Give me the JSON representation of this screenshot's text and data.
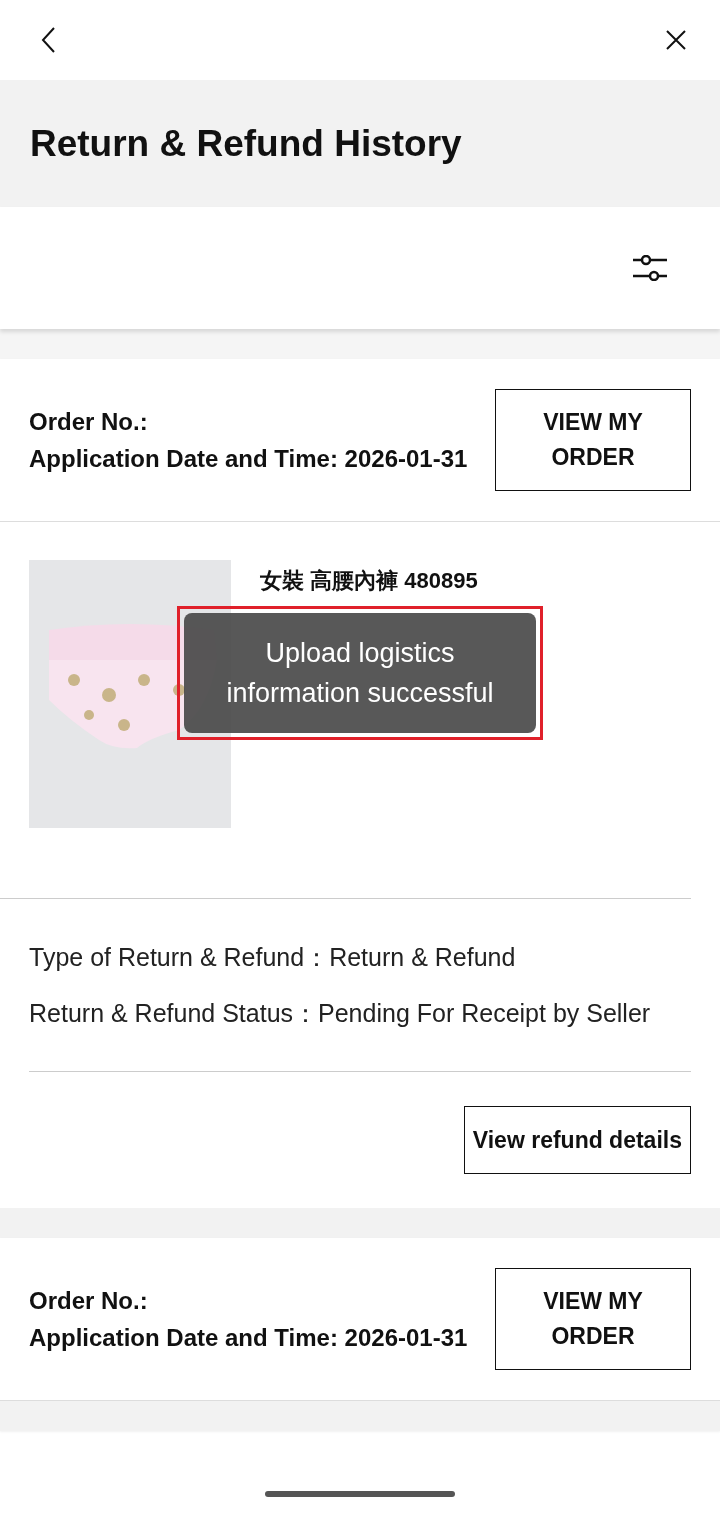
{
  "title": "Return & Refund History",
  "orders": [
    {
      "order_label": "Order No.:",
      "date_line": "Application Date and Time: 2026-01-31",
      "button": "VIEW MY ORDER",
      "product": {
        "name": "女裝 高腰內褲 480895"
      },
      "type_line": "Type of Return & Refund：Return & Refund",
      "status_line": "Return & Refund Status：Pending For Receipt by Seller",
      "details_button": "View refund details"
    },
    {
      "order_label": "Order No.:",
      "date_line": "Application Date and Time: 2026-01-31",
      "button": "VIEW MY ORDER"
    }
  ],
  "toast": {
    "text": "Upload logistics information successful",
    "highlighted": true
  }
}
